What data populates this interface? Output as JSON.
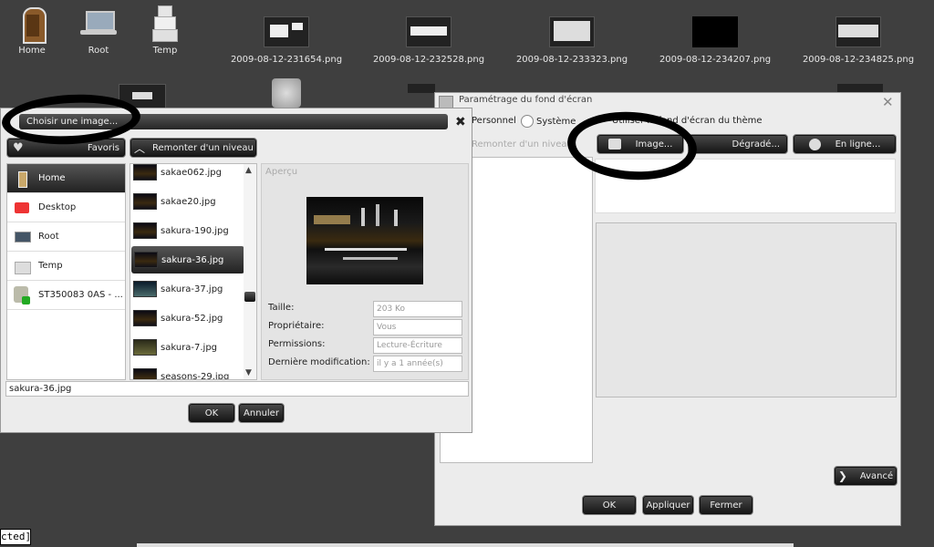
{
  "desktop": {
    "icons": [
      {
        "label": "Home",
        "icon": "door-icon"
      },
      {
        "label": "Root",
        "icon": "laptop-icon"
      },
      {
        "label": "Temp",
        "icon": "boxes-icon"
      }
    ],
    "thumbnails": [
      "2009-08-12-231654.png",
      "2009-08-12-232528.png",
      "2009-08-12-233323.png",
      "2009-08-12-234207.png",
      "2009-08-12-234825.png"
    ]
  },
  "chooser": {
    "title": "Choisir une image...",
    "favorites_label": "Favoris",
    "up_label": "Remonter d'un niveau",
    "places": [
      {
        "label": "Home",
        "icon": "home-icon",
        "selected": true
      },
      {
        "label": "Desktop",
        "icon": "desktop-icon"
      },
      {
        "label": "Root",
        "icon": "laptop-icon"
      },
      {
        "label": "Temp",
        "icon": "folder-icon"
      },
      {
        "label": "ST350083 0AS - ...",
        "icon": "harddisk-icon"
      }
    ],
    "files": [
      {
        "name": "sakae062.jpg"
      },
      {
        "name": "sakae20.jpg"
      },
      {
        "name": "sakura-190.jpg"
      },
      {
        "name": "sakura-36.jpg",
        "selected": true
      },
      {
        "name": "sakura-37.jpg"
      },
      {
        "name": "sakura-52.jpg"
      },
      {
        "name": "sakura-7.jpg"
      },
      {
        "name": "seasons-29.jpg"
      }
    ],
    "preview_title": "Aperçu",
    "props": [
      {
        "label": "Taille:",
        "value": "203 Ko"
      },
      {
        "label": "Propriétaire:",
        "value": "Vous"
      },
      {
        "label": "Permissions:",
        "value": "Lecture-Écriture"
      },
      {
        "label": "Dernière modification:",
        "value": "il y a 1 année(s)"
      }
    ],
    "filename": "sakura-36.jpg",
    "ok_label": "OK",
    "cancel_label": "Annuler"
  },
  "wallpaper": {
    "title": "Paramétrage du fond d'écran",
    "tab_personal": "Personnel",
    "tab_system": "Système",
    "use_theme": "Utiliser le fond d'écran du thème",
    "up_label": "Remonter d'un niveau",
    "image_btn": "Image...",
    "gradient_btn": "Dégradé...",
    "online_btn": "En ligne...",
    "advanced_btn": "Avancé",
    "ok_label": "OK",
    "apply_label": "Appliquer",
    "close_label": "Fermer"
  },
  "terminal": {
    "text": "cted]"
  }
}
